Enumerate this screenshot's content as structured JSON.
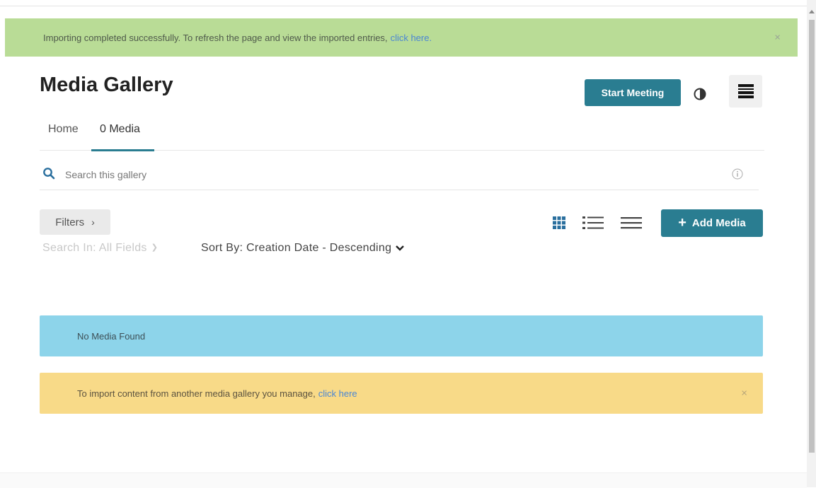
{
  "alerts": {
    "import_success": {
      "message": "Importing completed successfully. To refresh the page and view the imported entries,",
      "link": "click here.",
      "close": "×"
    },
    "no_media": {
      "message": "No Media Found"
    },
    "import_hint": {
      "message": "To import content from another media gallery you manage,",
      "link": "click here",
      "close": "×"
    }
  },
  "header": {
    "title": "Media Gallery",
    "start_meeting_label": "Start Meeting"
  },
  "tabs": [
    {
      "label": "Home"
    },
    {
      "label": "0 Media"
    }
  ],
  "search": {
    "placeholder": "Search this gallery"
  },
  "toolbar": {
    "filters_label": "Filters",
    "filters_chevron": "›",
    "add_media_icon": "+",
    "add_media_label": "Add Media",
    "search_in_label": "Search In: All Fields",
    "sort_by_label": "Sort By: Creation Date - Descending"
  },
  "icons": {
    "search": "search-icon",
    "info": "info-icon",
    "contrast": "contrast-icon",
    "menu": "hamburger-menu-icon",
    "grid_view": "grid-view-icon",
    "detailed_view": "list-view-icon",
    "compact_view": "compact-list-icon"
  },
  "colors": {
    "accent": "#2a7d91",
    "success_bg": "#b9dc96",
    "info_bg": "#8dd4ea",
    "warning_bg": "#f8da88",
    "link": "#4a86d4"
  }
}
